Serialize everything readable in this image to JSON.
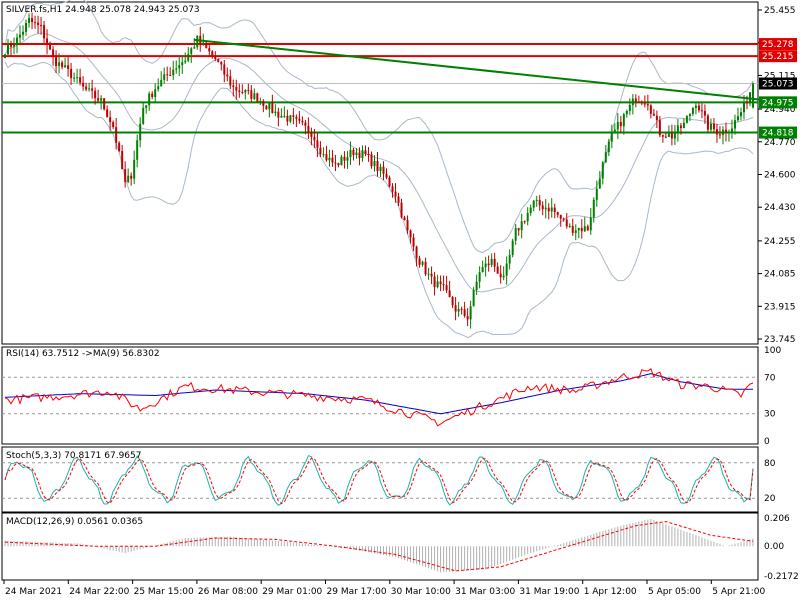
{
  "main": {
    "header": "SILVER.fs,H1  24.948 25.078 24.943 25.073",
    "y_ticks": [
      "25.455",
      "25.285",
      "25.115",
      "24.940",
      "24.770",
      "24.600",
      "24.430",
      "24.255",
      "24.085",
      "23.915",
      "23.745"
    ],
    "price_boxes": [
      {
        "label": "25.278",
        "bg": "#e00000",
        "fg": "#ffffff"
      },
      {
        "label": "25.215",
        "bg": "#e00000",
        "fg": "#ffffff"
      },
      {
        "label": "25.073",
        "bg": "#000000",
        "fg": "#ffffff"
      },
      {
        "label": "24.975",
        "bg": "#008000",
        "fg": "#ffffff"
      },
      {
        "label": "24.818",
        "bg": "#008000",
        "fg": "#ffffff"
      }
    ]
  },
  "rsi": {
    "header": "RSI(14) 63.7512  ->MA(9) 56.8302",
    "y_ticks": [
      "100",
      "70",
      "30",
      "0"
    ]
  },
  "stoch": {
    "header": "Stoch(5,3,3) 70.8171 67.9657",
    "y_ticks": [
      "80",
      "20"
    ]
  },
  "macd": {
    "header": "MACD(12,26,9) 0.0561 0.0365",
    "y_ticks": [
      "0.206",
      "0.00",
      "-0.2172"
    ]
  },
  "x_axis": {
    "labels": [
      "24 Mar 2021",
      "24 Mar 22:00",
      "25 Mar 15:00",
      "26 Mar 08:00",
      "29 Mar 01:00",
      "29 Mar 17:00",
      "30 Mar 10:00",
      "31 Mar 03:00",
      "31 Mar 19:00",
      "1 Apr 12:00",
      "5 Apr 05:00",
      "5 Apr 21:00"
    ]
  },
  "colors": {
    "bull": "#008000",
    "bear": "#c00000",
    "bands": "#a8b8cc",
    "support": "#008000",
    "resistance": "#e00000",
    "trendline": "#008000",
    "rsi_line": "#ff0000",
    "rsi_ma": "#0000cc",
    "stoch_main": "#20b2aa",
    "stoch_signal": "#ff0000",
    "macd_hist": "#b0b0b0",
    "macd_signal": "#ff0000"
  },
  "chart_data": [
    {
      "type": "candlestick",
      "symbol": "SILVER.fs",
      "timeframe": "H1",
      "last": {
        "open": 24.948,
        "high": 25.078,
        "low": 24.943,
        "close": 25.073
      },
      "ylim": [
        23.745,
        25.455
      ],
      "horizontal_levels": {
        "resistance": [
          25.278,
          25.215
        ],
        "support": [
          24.975,
          24.818
        ]
      },
      "trendline": {
        "from": {
          "bar": 63,
          "price": 25.3
        },
        "to": {
          "bar": 251,
          "price": 24.99
        }
      },
      "bollinger_bands": true,
      "close_path": [
        [
          0,
          25.25
        ],
        [
          4,
          25.3
        ],
        [
          8,
          25.4
        ],
        [
          12,
          25.36
        ],
        [
          16,
          25.2
        ],
        [
          22,
          25.12
        ],
        [
          26,
          25.05
        ],
        [
          32,
          24.98
        ],
        [
          36,
          24.85
        ],
        [
          40,
          24.55
        ],
        [
          42,
          24.6
        ],
        [
          46,
          24.95
        ],
        [
          50,
          25.05
        ],
        [
          56,
          25.15
        ],
        [
          60,
          25.2
        ],
        [
          64,
          25.3
        ],
        [
          70,
          25.2
        ],
        [
          76,
          25.05
        ],
        [
          84,
          25.0
        ],
        [
          90,
          24.92
        ],
        [
          96,
          24.88
        ],
        [
          102,
          24.82
        ],
        [
          106,
          24.7
        ],
        [
          110,
          24.65
        ],
        [
          116,
          24.72
        ],
        [
          120,
          24.7
        ],
        [
          126,
          24.6
        ],
        [
          130,
          24.5
        ],
        [
          134,
          24.3
        ],
        [
          138,
          24.15
        ],
        [
          142,
          24.05
        ],
        [
          146,
          24.0
        ],
        [
          150,
          23.9
        ],
        [
          154,
          23.86
        ],
        [
          158,
          24.1
        ],
        [
          162,
          24.15
        ],
        [
          166,
          24.05
        ],
        [
          170,
          24.3
        ],
        [
          176,
          24.45
        ],
        [
          182,
          24.42
        ],
        [
          188,
          24.32
        ],
        [
          194,
          24.32
        ],
        [
          198,
          24.6
        ],
        [
          202,
          24.8
        ],
        [
          206,
          24.9
        ],
        [
          210,
          25.0
        ],
        [
          214,
          24.98
        ],
        [
          218,
          24.82
        ],
        [
          222,
          24.8
        ],
        [
          226,
          24.86
        ],
        [
          230,
          24.98
        ],
        [
          234,
          24.85
        ],
        [
          238,
          24.82
        ],
        [
          242,
          24.85
        ],
        [
          246,
          24.95
        ],
        [
          249,
          25.073
        ]
      ]
    },
    {
      "type": "line",
      "name": "RSI(14)",
      "ylim": [
        0,
        100
      ],
      "levels": [
        70,
        30
      ],
      "last": {
        "rsi": 63.7512,
        "ma": 56.8302
      },
      "series": [
        {
          "name": "RSI",
          "points": [
            [
              0,
              45
            ],
            [
              20,
              50
            ],
            [
              35,
              55
            ],
            [
              45,
              35
            ],
            [
              60,
              60
            ],
            [
              80,
              55
            ],
            [
              100,
              50
            ],
            [
              120,
              45
            ],
            [
              145,
              20
            ],
            [
              160,
              40
            ],
            [
              175,
              60
            ],
            [
              190,
              55
            ],
            [
              205,
              70
            ],
            [
              215,
              76
            ],
            [
              225,
              62
            ],
            [
              235,
              60
            ],
            [
              245,
              50
            ],
            [
              249,
              63.75
            ]
          ]
        },
        {
          "name": "MA",
          "points": [
            [
              0,
              48
            ],
            [
              25,
              52
            ],
            [
              50,
              50
            ],
            [
              70,
              56
            ],
            [
              100,
              52
            ],
            [
              120,
              45
            ],
            [
              145,
              30
            ],
            [
              165,
              42
            ],
            [
              185,
              56
            ],
            [
              205,
              66
            ],
            [
              215,
              74
            ],
            [
              225,
              65
            ],
            [
              240,
              57
            ],
            [
              249,
              56.83
            ]
          ]
        }
      ]
    },
    {
      "type": "line",
      "name": "Stoch(5,3,3)",
      "ylim": [
        0,
        100
      ],
      "levels": [
        80,
        20
      ],
      "last": {
        "k": 70.8171,
        "d": 67.9657
      },
      "oscillation": {
        "cycles": 13,
        "low": 15,
        "high": 85
      }
    },
    {
      "type": "bar",
      "name": "MACD(12,26,9)",
      "ylim": [
        -0.2172,
        0.206
      ],
      "last": {
        "macd": 0.0561,
        "signal": 0.0365
      },
      "macd_path": [
        [
          0,
          0.04
        ],
        [
          25,
          0.02
        ],
        [
          40,
          -0.05
        ],
        [
          60,
          0.06
        ],
        [
          75,
          0.07
        ],
        [
          95,
          0.03
        ],
        [
          115,
          -0.02
        ],
        [
          130,
          -0.08
        ],
        [
          145,
          -0.19
        ],
        [
          160,
          -0.17
        ],
        [
          175,
          -0.05
        ],
        [
          190,
          0.05
        ],
        [
          205,
          0.15
        ],
        [
          215,
          0.2
        ],
        [
          225,
          0.12
        ],
        [
          240,
          0.0
        ],
        [
          249,
          0.056
        ]
      ],
      "signal_path": [
        [
          0,
          0.03
        ],
        [
          30,
          0.0
        ],
        [
          50,
          0.0
        ],
        [
          70,
          0.06
        ],
        [
          90,
          0.05
        ],
        [
          110,
          0.0
        ],
        [
          130,
          -0.06
        ],
        [
          150,
          -0.18
        ],
        [
          165,
          -0.15
        ],
        [
          180,
          -0.05
        ],
        [
          195,
          0.05
        ],
        [
          210,
          0.15
        ],
        [
          220,
          0.18
        ],
        [
          235,
          0.08
        ],
        [
          249,
          0.0365
        ]
      ]
    }
  ]
}
